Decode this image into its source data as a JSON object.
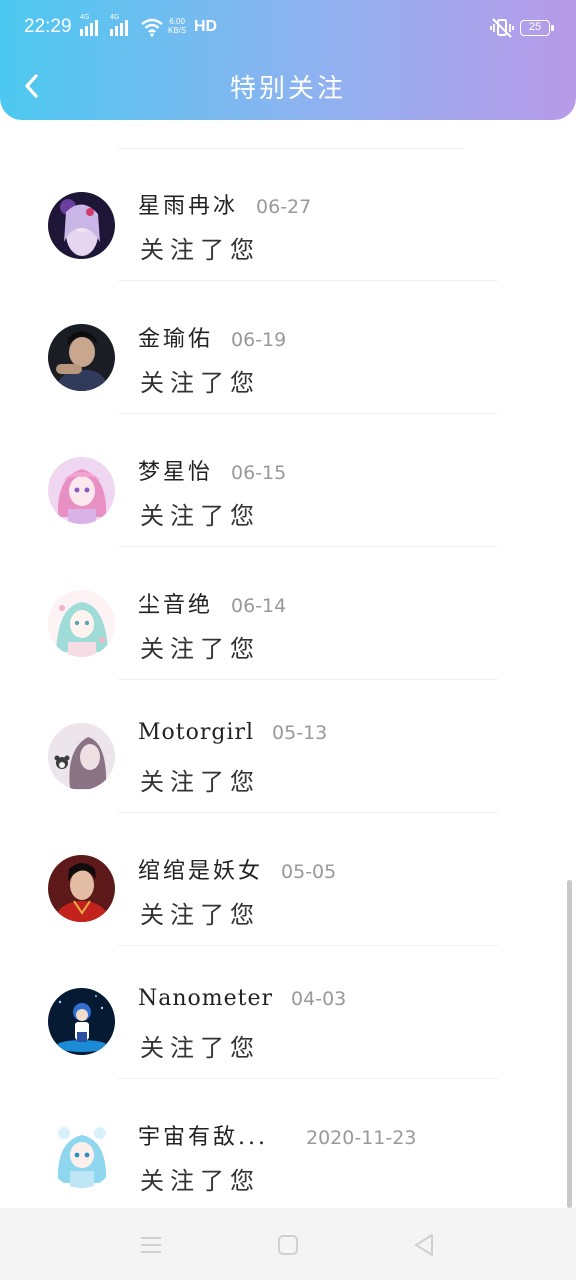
{
  "status_bar": {
    "time": "22:29",
    "signal1_tag": "4G",
    "signal2_tag": "4G",
    "net_speed_value": "6.00",
    "net_speed_unit": "KB/S",
    "hd": "HD",
    "battery": "25"
  },
  "header": {
    "title": "特别关注",
    "back_icon": "chevron-left-icon"
  },
  "items": [
    {
      "name": "星雨冉冰",
      "date": "06-27",
      "action": "关注了您"
    },
    {
      "name": "金瑜佑",
      "date": "06-19",
      "action": "关注了您"
    },
    {
      "name": "梦星怡",
      "date": "06-15",
      "action": "关注了您"
    },
    {
      "name": "尘音绝",
      "date": "06-14",
      "action": "关注了您"
    },
    {
      "name": "Motorgirl",
      "date": "05-13",
      "action": "关注了您"
    },
    {
      "name": "绾绾是妖女",
      "date": "05-05",
      "action": "关注了您"
    },
    {
      "name": "Nanometer",
      "date": "04-03",
      "action": "关注了您"
    },
    {
      "name": "宇宙有敌...",
      "date": "2020-11-23",
      "action": "关注了您"
    }
  ],
  "nav": {
    "menu_icon": "menu-icon",
    "home_icon": "home-square-icon",
    "back_icon": "back-triangle-icon"
  },
  "colors": {
    "header_gradient_start": "#4cc9f0",
    "header_gradient_end": "#b89ae8"
  }
}
